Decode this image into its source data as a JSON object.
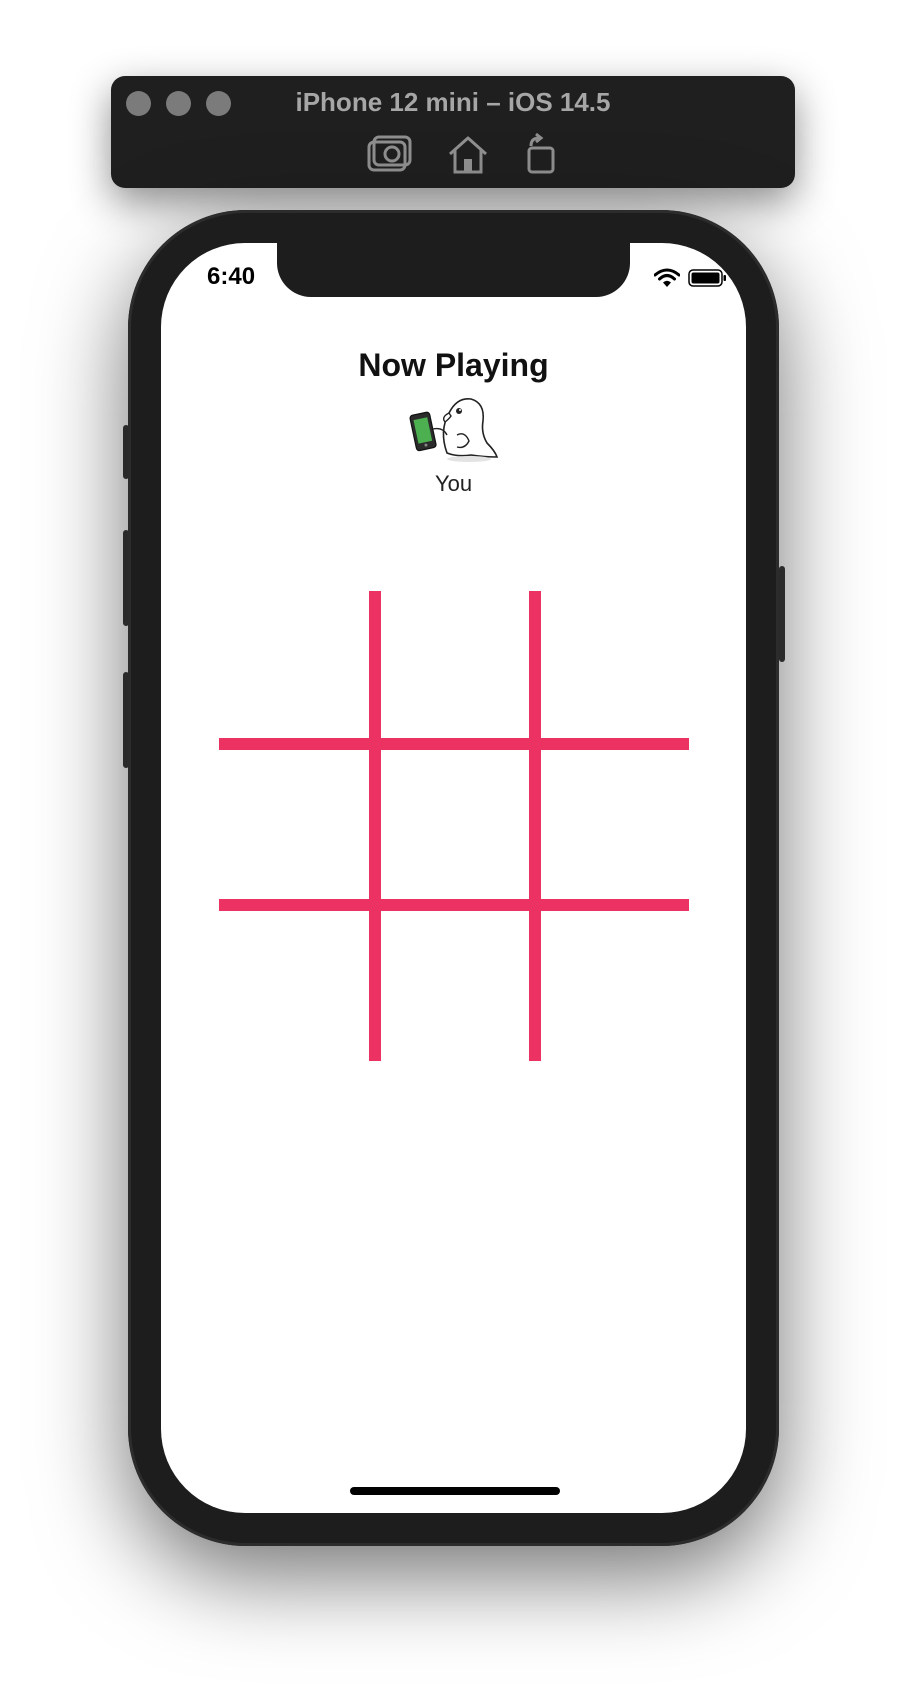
{
  "simulator": {
    "title": "iPhone 12 mini – iOS 14.5",
    "toolbar": {
      "screenshot_icon": "camera-icon",
      "home_icon": "home-icon",
      "rotate_icon": "rotate-icon"
    }
  },
  "status_bar": {
    "time": "6:40",
    "icons": [
      "wifi-icon",
      "battery-icon"
    ]
  },
  "game": {
    "header": "Now Playing",
    "player": {
      "name": "You",
      "avatar_icon": "bird-holding-phone-avatar"
    },
    "board": {
      "rows": 3,
      "columns": 3,
      "cells": [
        "",
        "",
        "",
        "",
        "",
        "",
        "",
        "",
        ""
      ],
      "line_color": "#ec3262"
    }
  }
}
